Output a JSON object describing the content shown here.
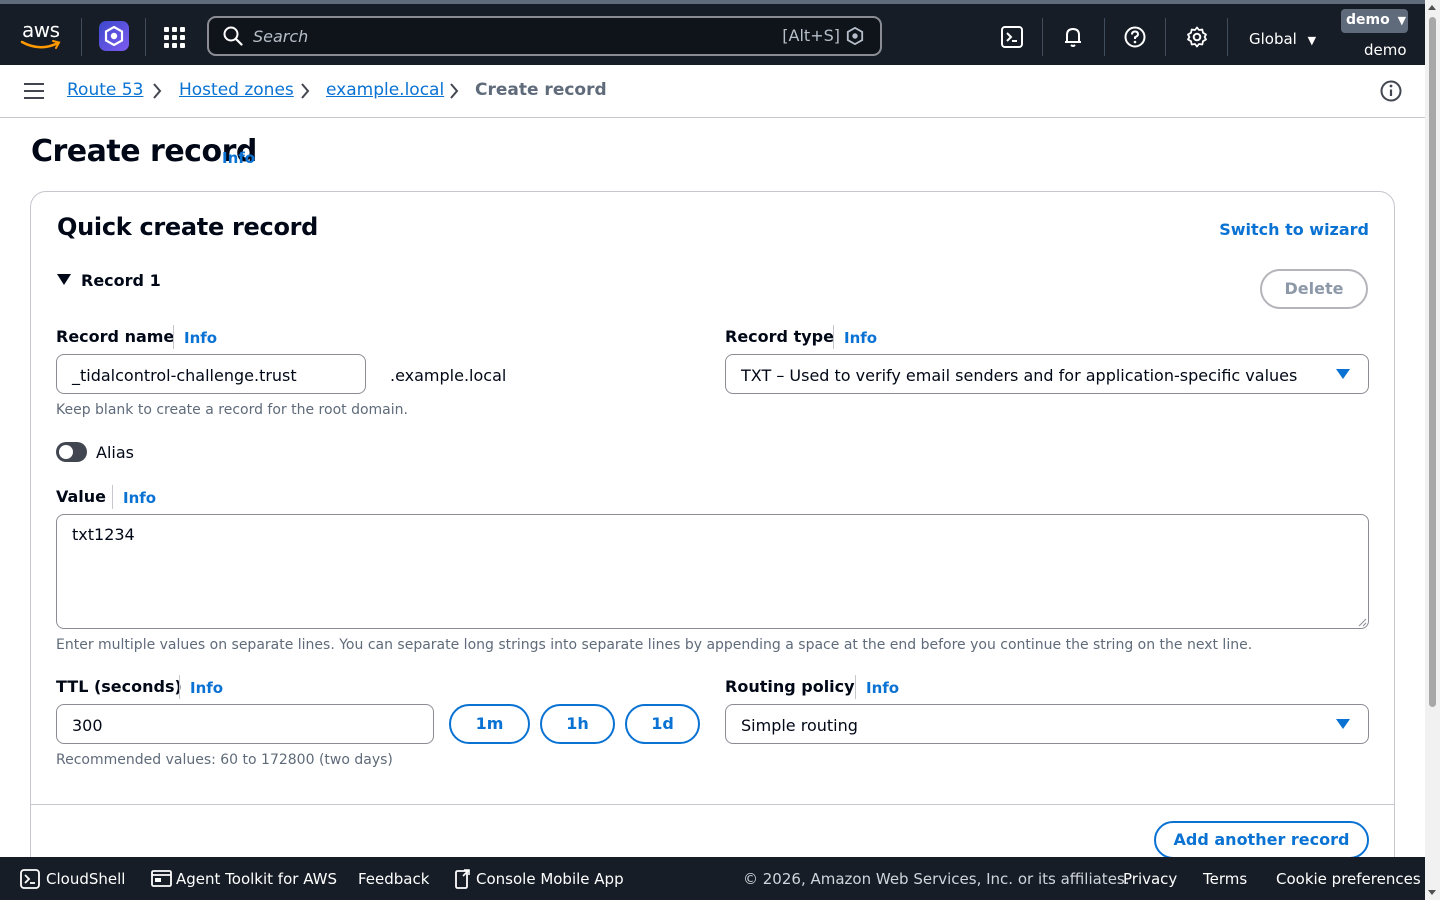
{
  "topnav": {
    "logo_text": "aws",
    "search_placeholder": "Search",
    "search_shortcut": "[Alt+S]",
    "region": "Global",
    "account_menu_label": "demo",
    "account_name": "demo",
    "icons": [
      "aws-logo",
      "app-icon",
      "services-grid-icon",
      "search-icon",
      "cloudshell-icon",
      "bell-icon",
      "help-icon",
      "settings-icon",
      "caret-down-icon"
    ]
  },
  "breadcrumb": {
    "items": [
      "Route 53",
      "Hosted zones",
      "example.local"
    ],
    "current": "Create record"
  },
  "page": {
    "title": "Create record",
    "info": "Info"
  },
  "form": {
    "card_title": "Quick create record",
    "switch_wizard": "Switch to wizard",
    "record_section": "Record 1",
    "delete": "Delete",
    "record_name": {
      "label": "Record name",
      "info": "Info",
      "value": "_tidalcontrol-challenge.trust",
      "suffix": ".example.local",
      "hint": "Keep blank to create a record for the root domain."
    },
    "record_type": {
      "label": "Record type",
      "info": "Info",
      "value": "TXT – Used to verify email senders and for application-specific values"
    },
    "alias": {
      "label": "Alias",
      "enabled": false
    },
    "value": {
      "label": "Value",
      "info": "Info",
      "value": "txt1234",
      "hint": "Enter multiple values on separate lines. You can separate long strings into separate lines by appending a space at the end before you continue the string on the next line."
    },
    "ttl": {
      "label": "TTL (seconds)",
      "info": "Info",
      "value": "300",
      "presets": [
        "1m",
        "1h",
        "1d"
      ],
      "hint": "Recommended values: 60 to 172800 (two days)"
    },
    "routing_policy": {
      "label": "Routing policy",
      "info": "Info",
      "value": "Simple routing"
    },
    "add_another": "Add another record"
  },
  "footer": {
    "cloudshell": "CloudShell",
    "agent_toolkit": "Agent Toolkit for AWS",
    "feedback": "Feedback",
    "mobile_app": "Console Mobile App",
    "copyright": "© 2026, Amazon Web Services, Inc. or its affiliates.",
    "privacy": "Privacy",
    "terms": "Terms",
    "cookies": "Cookie preferences"
  },
  "colors": {
    "nav_bg": "#161d26",
    "link": "#0972d3",
    "text": "#000716",
    "muted": "#5f6b7a",
    "border": "#8c8c94"
  }
}
